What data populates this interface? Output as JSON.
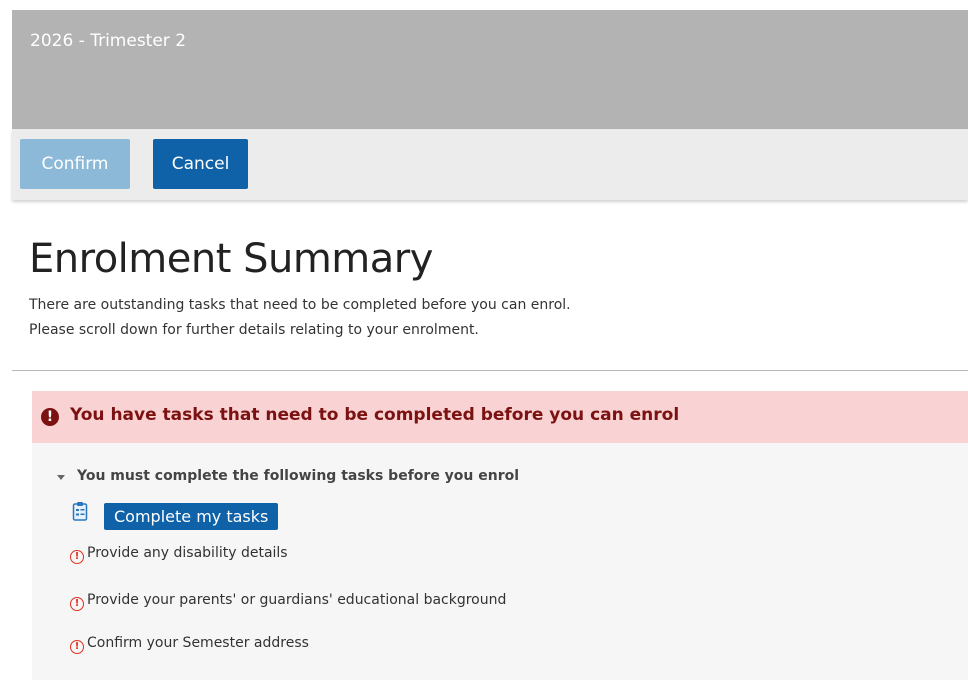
{
  "header": {
    "title": "2026 - Trimester 2"
  },
  "toolbar": {
    "confirm_label": "Confirm",
    "cancel_label": "Cancel"
  },
  "summary": {
    "title": "Enrolment Summary",
    "line1": "There are outstanding tasks that need to be completed before you can enrol.",
    "line2": "Please scroll down for further details relating to your enrolment."
  },
  "alert": {
    "icon": "exclamation-circle-icon",
    "message": "You have tasks that need to be completed before you can enrol"
  },
  "tasks": {
    "heading": "You must complete the following tasks before you enrol",
    "button_label": "Complete my tasks",
    "items": [
      {
        "label": "Provide any disability details"
      },
      {
        "label": "Provide your parents' or guardians' educational background"
      },
      {
        "label": "Confirm your Semester address"
      }
    ]
  },
  "colors": {
    "accent": "#0f62a8",
    "alert_bg": "#f9d3d3",
    "alert_text": "#7b1111",
    "warning": "#e0301e"
  }
}
